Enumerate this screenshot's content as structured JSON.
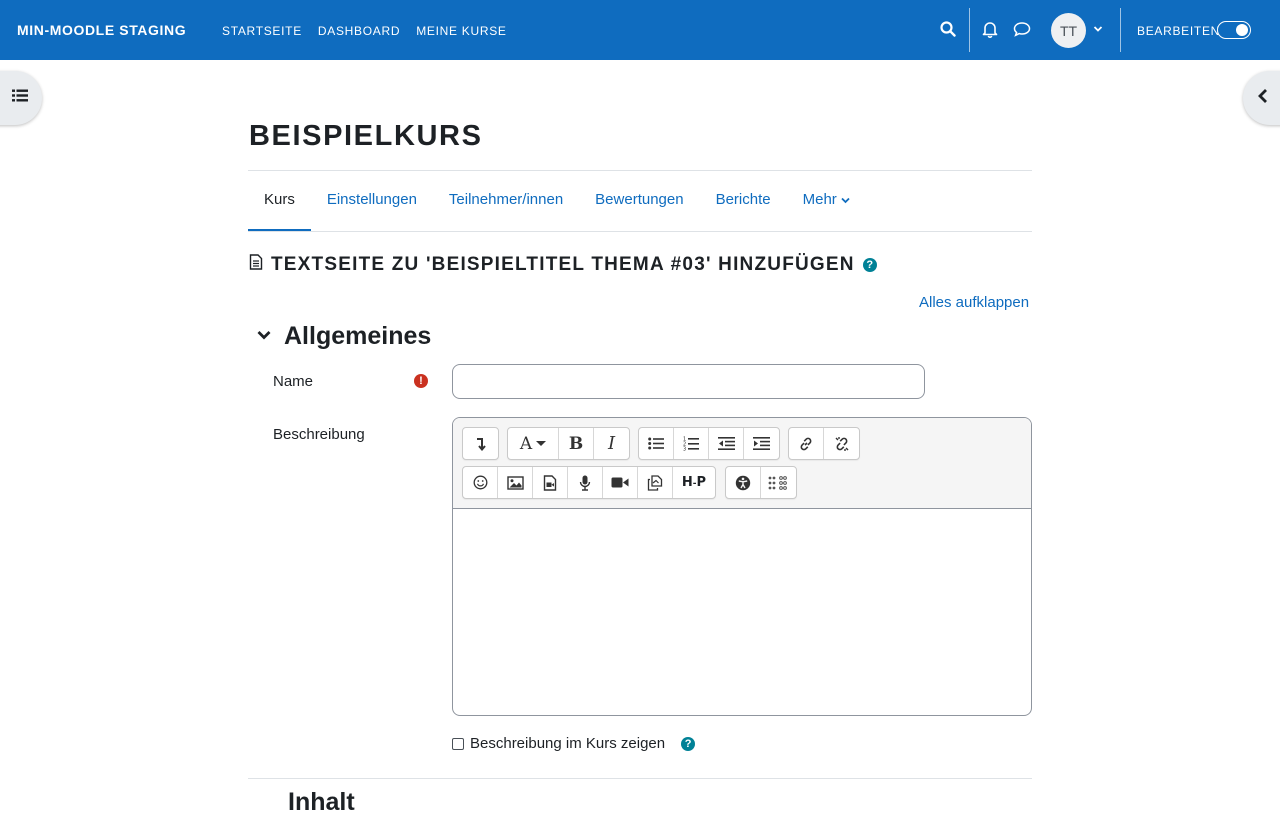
{
  "navbar": {
    "brand": "MIN-MOODLE STAGING",
    "links": [
      "STARTSEITE",
      "DASHBOARD",
      "MEINE KURSE"
    ],
    "avatar_initials": "TT",
    "edit_mode_label": "BEARBEITEN",
    "edit_mode_on": true,
    "icons": [
      "search-icon",
      "bell-icon",
      "chat-bubble-icon",
      "chevron-down-icon"
    ]
  },
  "drawers": {
    "left_icon": "list-icon",
    "right_icon": "chevron-left-icon"
  },
  "course": {
    "title": "BEISPIELKURS"
  },
  "tabs": [
    {
      "label": "Kurs",
      "active": true
    },
    {
      "label": "Einstellungen",
      "active": false
    },
    {
      "label": "Teilnehmer/innen",
      "active": false
    },
    {
      "label": "Bewertungen",
      "active": false
    },
    {
      "label": "Berichte",
      "active": false
    },
    {
      "label": "Mehr",
      "active": false
    }
  ],
  "form": {
    "heading": "TEXTSEITE ZU 'BEISPIELTITEL THEMA #03' HINZUFÜGEN",
    "expand_all": "Alles aufklappen",
    "section_general": "Allgemeines",
    "name_label": "Name",
    "name_value": "",
    "description_label": "Beschreibung",
    "show_description_label": "Beschreibung im Kurs zeigen",
    "show_description_checked": false,
    "next_section": "Inhalt"
  },
  "editor_toolbar": {
    "row1": [
      [
        "collapse-icon"
      ],
      [
        "font-style-icon",
        "bold-icon",
        "italic-icon"
      ],
      [
        "unordered-list-icon",
        "ordered-list-icon",
        "outdent-icon",
        "indent-icon"
      ],
      [
        "link-icon",
        "unlink-icon"
      ]
    ],
    "row2": [
      [
        "emoji-icon",
        "image-icon",
        "media-icon",
        "record-audio-icon",
        "record-video-icon",
        "manage-files-icon",
        "h5p-icon"
      ],
      [
        "accessibility-checker-icon",
        "screenreader-helper-icon"
      ]
    ]
  },
  "colors": {
    "brand": "#0f6cbf",
    "help": "#008196",
    "required": "#ca3120"
  }
}
